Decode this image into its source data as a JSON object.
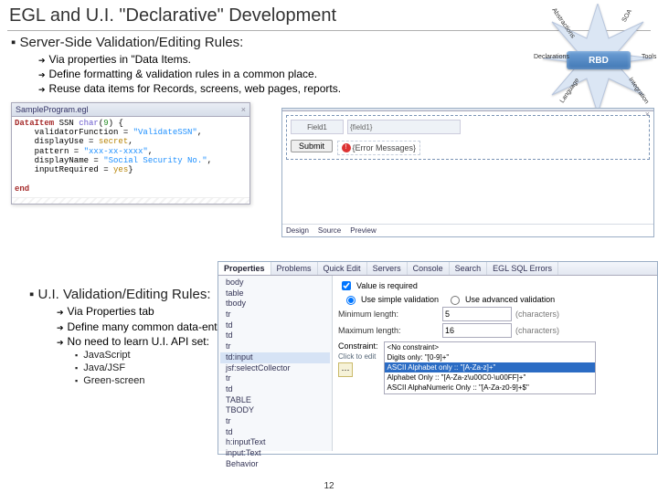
{
  "slide": {
    "title": "EGL and U.I. \"Declarative\" Development",
    "page_number": "12"
  },
  "starburst": {
    "center": "RBD",
    "rays": {
      "declarations": "Declarations",
      "tools": "Tools",
      "soa": "SOA",
      "abstractions": "Abstractions",
      "language": "Language",
      "integration": "Integration"
    }
  },
  "section1": {
    "heading": "Server-Side Validation/Editing Rules:",
    "bullets": [
      "Via properties in \"Data Items.",
      "Define formatting & validation rules in a common place.",
      "Reuse data items for Records, screens, web pages, reports."
    ]
  },
  "code_pane": {
    "tab": "SampleProgram.egl",
    "lines": {
      "l1a": "DataItem",
      "l1b": " SSN ",
      "l1c": "char",
      "l1d": "(",
      "l1e": "9",
      "l1f": ") {",
      "l2a": "    validatorFunction = ",
      "l2b": "\"ValidateSSN\"",
      "l2c": ",",
      "l3a": "    displayUse = ",
      "l3b": "secret",
      "l3c": ",",
      "l4a": "    pattern = ",
      "l4b": "\"xxx-xx-xxxx\"",
      "l4c": ",",
      "l5a": "    displayName = ",
      "l5b": "\"Social Security No.\"",
      "l5c": ",",
      "l6a": "    inputRequired = ",
      "l6b": "yes",
      "l6c": "}",
      "l7": "",
      "l8": "end"
    }
  },
  "form_editor": {
    "tab_close": "×",
    "field_label": "Field1",
    "field_value": "{field1}",
    "submit": "Submit",
    "error_area": "{Error Messages}",
    "footer_tabs": [
      "Design",
      "Source",
      "Preview"
    ]
  },
  "properties": {
    "tabs": [
      "Properties",
      "Problems",
      "Quick Edit",
      "Servers",
      "Console",
      "Search",
      "EGL SQL Errors"
    ],
    "active_tab_index": 0,
    "tree": [
      "body",
      " table",
      "  tbody",
      "   tr",
      "    td",
      "    td",
      "   tr",
      "    td:input",
      "     jsf:selectCollector",
      "   tr",
      "    td",
      "     TABLE",
      "     TBODY",
      "      tr",
      "       td",
      "        h:inputText",
      "         input:Text",
      "         Behavior"
    ],
    "form": {
      "value_required_label": "Value is required",
      "value_required_checked": true,
      "radio_simple": "Use simple validation",
      "radio_advanced": "Use advanced validation",
      "min_label": "Minimum length:",
      "min_value": "5",
      "max_label": "Maximum length:",
      "max_value": "16",
      "unit": "(characters)",
      "constraint_label": "Constraint:",
      "click_hint": "Click to edit",
      "options": [
        "<No constraint>",
        "Digits only: \"[0-9]+\"",
        "ASCII Alphabet only :: \"[A-Za-z]+\"",
        "Alphabet Only :: \"[A-Za-z\\u00C0-\\u00FF]+\"",
        "ASCII AlphaNumeric Only :: \"[A-Za-z0-9]+$\""
      ],
      "selected_option_index": 2
    }
  },
  "section2": {
    "heading": "U.I. Validation/Editing Rules:",
    "bullets": [
      "Via Properties tab",
      "Define many common data-entry requirements",
      "No need to learn U.I. API set:"
    ],
    "subbullets": [
      "JavaScript",
      "Java/JSF",
      "Green-screen"
    ]
  }
}
